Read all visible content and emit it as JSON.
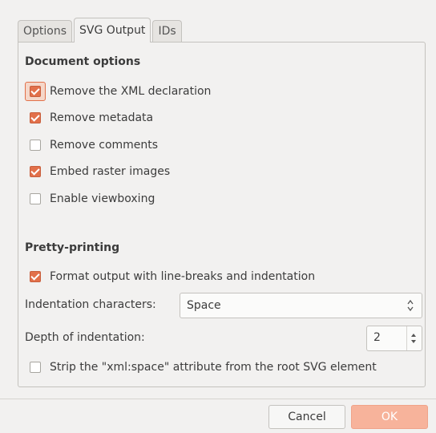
{
  "tabs": [
    "Options",
    "SVG Output",
    "IDs"
  ],
  "document_options": {
    "heading": "Document options",
    "items": [
      {
        "label": "Remove the XML declaration",
        "checked": true
      },
      {
        "label": "Remove metadata",
        "checked": true
      },
      {
        "label": "Remove comments",
        "checked": false
      },
      {
        "label": "Embed raster images",
        "checked": true
      },
      {
        "label": "Enable viewboxing",
        "checked": false
      }
    ]
  },
  "pretty_printing": {
    "heading": "Pretty-printing",
    "format_output": {
      "label": "Format output with line-breaks and indentation",
      "checked": true
    },
    "indentation_label": "Indentation characters:",
    "indentation_value": "Space",
    "depth_label": "Depth of indentation:",
    "depth_value": "2",
    "strip_xml_space": {
      "label": "Strip the \"xml:space\" attribute from the root SVG element",
      "checked": false
    }
  },
  "buttons": {
    "cancel": "Cancel",
    "ok": "OK"
  },
  "colors": {
    "accent": "#e2704a",
    "ok_button": "#f7b39b"
  }
}
